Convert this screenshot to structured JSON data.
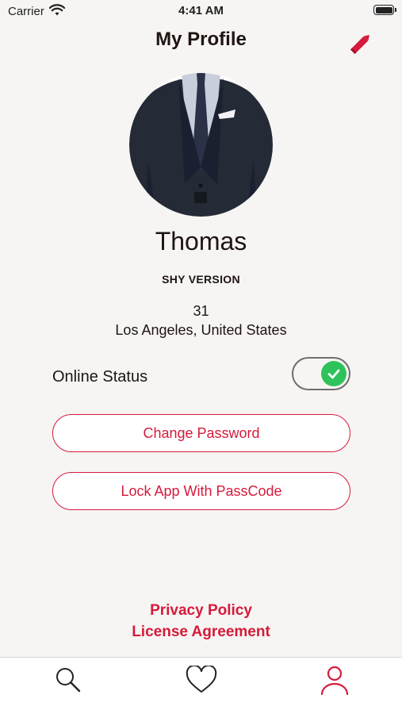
{
  "status_bar": {
    "carrier": "Carrier",
    "time": "4:41 AM"
  },
  "header": {
    "title": "My Profile",
    "edit_icon": "pencil-icon"
  },
  "profile": {
    "name": "Thomas",
    "version": "SHY VERSION",
    "age": "31",
    "location": "Los Angeles, United States"
  },
  "online_status": {
    "label": "Online Status",
    "enabled": true
  },
  "buttons": {
    "change_password": "Change Password",
    "lock_app": "Lock App With PassCode"
  },
  "links": {
    "privacy": "Privacy Policy",
    "license": "License Agreement"
  },
  "tab_bar": {
    "items": [
      {
        "icon": "search-icon",
        "active": false
      },
      {
        "icon": "heart-icon",
        "active": false
      },
      {
        "icon": "person-icon",
        "active": true
      }
    ]
  },
  "colors": {
    "accent": "#d41b3b",
    "text": "#1e1512",
    "toggle_on": "#2ec35a",
    "background": "#f7f5f3"
  }
}
